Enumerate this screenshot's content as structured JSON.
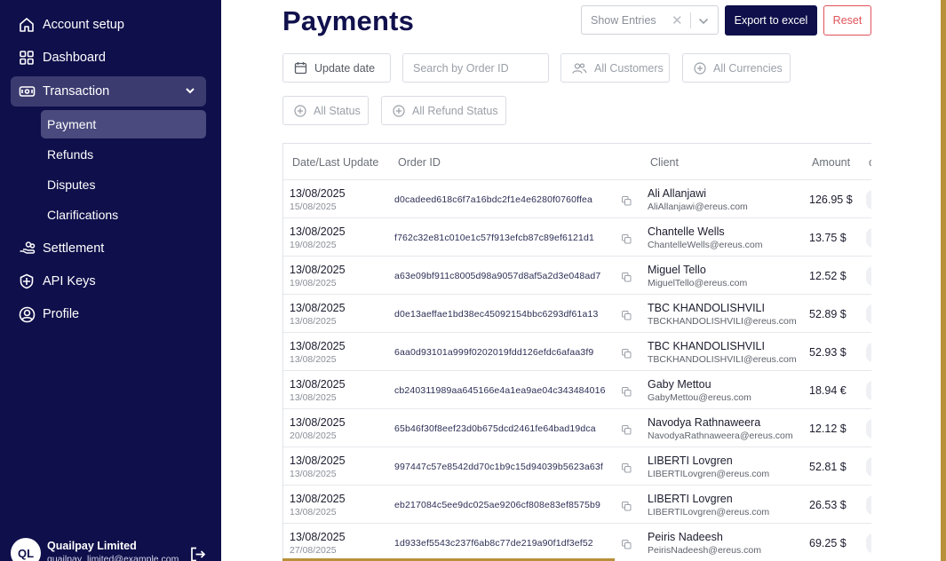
{
  "sidebar": {
    "items": [
      {
        "label": "Account setup",
        "icon": "home-icon"
      },
      {
        "label": "Dashboard",
        "icon": "grid-icon"
      },
      {
        "label": "Transaction",
        "icon": "wallet-icon"
      },
      {
        "label": "Settlement",
        "icon": "settlement-icon"
      },
      {
        "label": "API Keys",
        "icon": "api-key-icon"
      },
      {
        "label": "Profile",
        "icon": "user-icon"
      }
    ],
    "sub_items": [
      {
        "label": "Payment",
        "active": true
      },
      {
        "label": "Refunds"
      },
      {
        "label": "Disputes"
      },
      {
        "label": "Clarifications"
      }
    ],
    "user": {
      "initials": "QL",
      "name": "Quailpay Limited",
      "email": "quailpay_limited@example.com"
    }
  },
  "header": {
    "title": "Payments",
    "show_entries_placeholder": "Show Entries",
    "export_label": "Export to excel",
    "reset_label": "Reset"
  },
  "filters": {
    "update_date": "Update date",
    "search_placeholder": "Search by Order ID",
    "customers": "All Customers",
    "currencies": "All Currencies",
    "status": "All Status",
    "refund_status": "All Refund Status"
  },
  "table": {
    "columns": [
      "Date/Last Update",
      "Order ID",
      "Client",
      "Amount"
    ],
    "rows": [
      {
        "date": "13/08/2025",
        "updated": "15/08/2025",
        "order_id": "d0cadeed618c6f7a16bdc2f1e4e6280f0760ffea",
        "name": "Ali Allanjawi",
        "email": "AliAllanjawi@ereus.com",
        "amount": "126.95 $"
      },
      {
        "date": "13/08/2025",
        "updated": "19/08/2025",
        "order_id": "f762c32e81c010e1c57f913efcb87c89ef6121d1",
        "name": "Chantelle Wells",
        "email": "ChantelleWells@ereus.com",
        "amount": "13.75 $"
      },
      {
        "date": "13/08/2025",
        "updated": "19/08/2025",
        "order_id": "a63e09bf911c8005d98a9057d8af5a2d3e048ad7",
        "name": "Miguel Tello",
        "email": "MiguelTello@ereus.com",
        "amount": "12.52 $"
      },
      {
        "date": "13/08/2025",
        "updated": "13/08/2025",
        "order_id": "d0e13aeffae1bd38ec45092154bbc6293df61a13",
        "name": "TBC KHANDOLISHVILI",
        "email": "TBCKHANDOLISHVILI@ereus.com",
        "amount": "52.89 $"
      },
      {
        "date": "13/08/2025",
        "updated": "13/08/2025",
        "order_id": "6aa0d93101a999f0202019fdd126efdc6afaa3f9",
        "name": "TBC KHANDOLISHVILI",
        "email": "TBCKHANDOLISHVILI@ereus.com",
        "amount": "52.93 $"
      },
      {
        "date": "13/08/2025",
        "updated": "13/08/2025",
        "order_id": "cb240311989aa645166e4a1ea9ae04c343484016",
        "name": "Gaby Mettou",
        "email": "GabyMettou@ereus.com",
        "amount": "18.94 €"
      },
      {
        "date": "13/08/2025",
        "updated": "20/08/2025",
        "order_id": "65b46f30f8eef23d0b675dcd2461fe64bad19dca",
        "name": "Navodya Rathnaweera",
        "email": "NavodyaRathnaweera@ereus.com",
        "amount": "12.12 $"
      },
      {
        "date": "13/08/2025",
        "updated": "13/08/2025",
        "order_id": "997447c57e8542dd70c1b9c15d94039b5623a63f",
        "name": "LIBERTI Lovgren",
        "email": "LIBERTILovgren@ereus.com",
        "amount": "52.81 $"
      },
      {
        "date": "13/08/2025",
        "updated": "13/08/2025",
        "order_id": "eb217084c5ee9dc025ae9206cf808e83ef8575b9",
        "name": "LIBERTI Lovgren",
        "email": "LIBERTILovgren@ereus.com",
        "amount": "26.53 $"
      },
      {
        "date": "13/08/2025",
        "updated": "27/08/2025",
        "order_id": "1d933ef5543c237f6ab8c77de219a90f1df3ef52",
        "name": "Peiris Nadeesh",
        "email": "PeirisNadeesh@ereus.com",
        "amount": "69.25 $"
      }
    ]
  },
  "colors": {
    "sidebar_bg": "#0f0f4b",
    "accent": "#b8913a",
    "danger": "#e0525a"
  }
}
